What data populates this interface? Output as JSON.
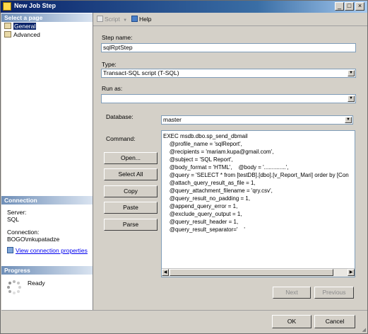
{
  "window": {
    "title": "New Job Step"
  },
  "left": {
    "select_page_header": "Select a page",
    "pages": [
      {
        "label": "General",
        "selected": true,
        "icon": "general-page-icon"
      },
      {
        "label": "Advanced",
        "selected": false,
        "icon": "advanced-page-icon"
      }
    ],
    "connection_header": "Connection",
    "server_label": "Server:",
    "server_value": "SQL",
    "connection_label": "Connection:",
    "connection_value": "BOGO\\mkupatadze",
    "view_props_link": "View connection properties",
    "progress_header": "Progress",
    "progress_status": "Ready"
  },
  "toolbar": {
    "script_label": "Script",
    "help_label": "Help"
  },
  "form": {
    "step_name_label": "Step name:",
    "step_name_value": "sqlRptStep",
    "type_label": "Type:",
    "type_value": "Transact-SQL script (T-SQL)",
    "run_as_label": "Run as:",
    "run_as_value": "",
    "database_label": "Database:",
    "database_value": "master",
    "command_label": "Command:",
    "command_lines": [
      "EXEC msdb.dbo.sp_send_dbmail",
      "    @profile_name = 'sqlReport',",
      "    @recipients = 'mariam.kupa@gmail.com',",
      "    @subject = 'SQL Report',",
      "    @body_format = 'HTML',    @body = '..............',",
      "    @query = 'SELECT * from [testDB].[dbo].[v_Report_Mari] order by [Con",
      "    @attach_query_result_as_file = 1,",
      "    @query_attachment_filename = 'qry.csv',",
      "    @query_result_no_padding = 1,",
      "    @append_query_error = 1,",
      "    @exclude_query_output = 1,",
      "    @query_result_header = 1,",
      "    @query_result_separator='    '"
    ]
  },
  "buttons": {
    "open": "Open...",
    "select_all": "Select All",
    "copy": "Copy",
    "paste": "Paste",
    "parse": "Parse",
    "next": "Next",
    "previous": "Previous",
    "ok": "OK",
    "cancel": "Cancel"
  },
  "colors": {
    "title_bar": "#0a246a",
    "link": "#0000ee",
    "selection": "#0a246a"
  }
}
